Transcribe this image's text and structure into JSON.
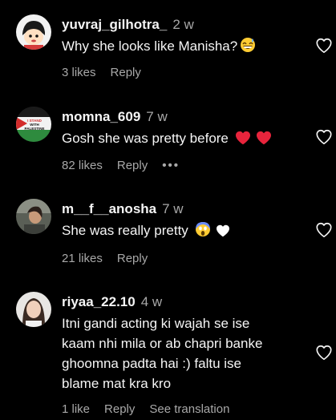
{
  "comments": [
    {
      "username": "yuvraj_gilhotra_",
      "time": "2 w",
      "text": "Why she looks like Manisha?",
      "emoji": "grinning-sweat-emoji",
      "likes": "3 likes",
      "reply": "Reply"
    },
    {
      "username": "momna_609",
      "time": "7 w",
      "text": "Gosh she was pretty before",
      "emoji": "two-red-hearts",
      "likes": "82 likes",
      "reply": "Reply",
      "more": "•••"
    },
    {
      "username": "m__f__anosha",
      "time": "7 w",
      "text": "She was really pretty",
      "emoji": "scream-and-white-heart",
      "likes": "21 likes",
      "reply": "Reply"
    },
    {
      "username": "riyaa_22.10",
      "time": "4 w",
      "text_lines": [
        "Itni gandi acting ki wajah se ise",
        "kaam nhi mila or ab chapri banke",
        "ghoomna padta hai :) faltu ise",
        "blame mat kra kro"
      ],
      "likes": "1 like",
      "reply": "Reply",
      "see_translation": "See translation"
    }
  ],
  "avatar_badge_text": [
    "I STAND",
    "WITH",
    "PALESTINE"
  ],
  "colors": {
    "background": "#000000",
    "primary_text": "#f5f5f5",
    "secondary_text": "#a8a8a8",
    "heart_red": "#ff3040"
  }
}
